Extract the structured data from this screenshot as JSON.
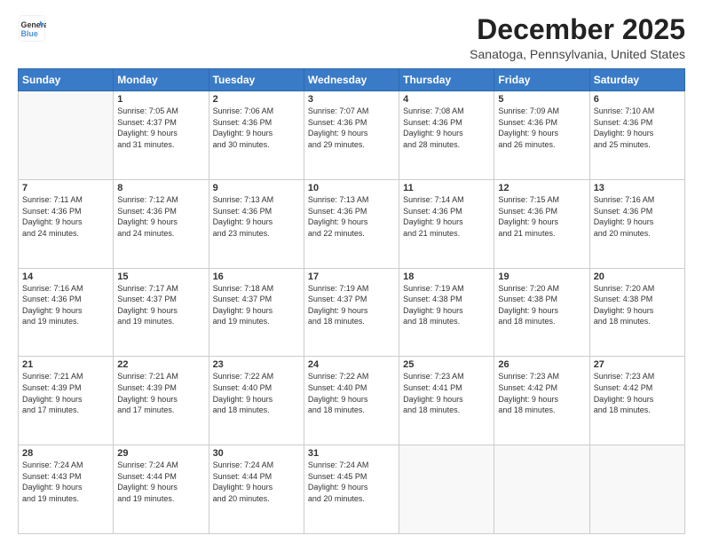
{
  "logo": {
    "line1": "General",
    "line2": "Blue"
  },
  "title": "December 2025",
  "subtitle": "Sanatoga, Pennsylvania, United States",
  "days_of_week": [
    "Sunday",
    "Monday",
    "Tuesday",
    "Wednesday",
    "Thursday",
    "Friday",
    "Saturday"
  ],
  "weeks": [
    [
      {
        "day": "",
        "info": ""
      },
      {
        "day": "1",
        "info": "Sunrise: 7:05 AM\nSunset: 4:37 PM\nDaylight: 9 hours\nand 31 minutes."
      },
      {
        "day": "2",
        "info": "Sunrise: 7:06 AM\nSunset: 4:36 PM\nDaylight: 9 hours\nand 30 minutes."
      },
      {
        "day": "3",
        "info": "Sunrise: 7:07 AM\nSunset: 4:36 PM\nDaylight: 9 hours\nand 29 minutes."
      },
      {
        "day": "4",
        "info": "Sunrise: 7:08 AM\nSunset: 4:36 PM\nDaylight: 9 hours\nand 28 minutes."
      },
      {
        "day": "5",
        "info": "Sunrise: 7:09 AM\nSunset: 4:36 PM\nDaylight: 9 hours\nand 26 minutes."
      },
      {
        "day": "6",
        "info": "Sunrise: 7:10 AM\nSunset: 4:36 PM\nDaylight: 9 hours\nand 25 minutes."
      }
    ],
    [
      {
        "day": "7",
        "info": "Sunrise: 7:11 AM\nSunset: 4:36 PM\nDaylight: 9 hours\nand 24 minutes."
      },
      {
        "day": "8",
        "info": "Sunrise: 7:12 AM\nSunset: 4:36 PM\nDaylight: 9 hours\nand 24 minutes."
      },
      {
        "day": "9",
        "info": "Sunrise: 7:13 AM\nSunset: 4:36 PM\nDaylight: 9 hours\nand 23 minutes."
      },
      {
        "day": "10",
        "info": "Sunrise: 7:13 AM\nSunset: 4:36 PM\nDaylight: 9 hours\nand 22 minutes."
      },
      {
        "day": "11",
        "info": "Sunrise: 7:14 AM\nSunset: 4:36 PM\nDaylight: 9 hours\nand 21 minutes."
      },
      {
        "day": "12",
        "info": "Sunrise: 7:15 AM\nSunset: 4:36 PM\nDaylight: 9 hours\nand 21 minutes."
      },
      {
        "day": "13",
        "info": "Sunrise: 7:16 AM\nSunset: 4:36 PM\nDaylight: 9 hours\nand 20 minutes."
      }
    ],
    [
      {
        "day": "14",
        "info": "Sunrise: 7:16 AM\nSunset: 4:36 PM\nDaylight: 9 hours\nand 19 minutes."
      },
      {
        "day": "15",
        "info": "Sunrise: 7:17 AM\nSunset: 4:37 PM\nDaylight: 9 hours\nand 19 minutes."
      },
      {
        "day": "16",
        "info": "Sunrise: 7:18 AM\nSunset: 4:37 PM\nDaylight: 9 hours\nand 19 minutes."
      },
      {
        "day": "17",
        "info": "Sunrise: 7:19 AM\nSunset: 4:37 PM\nDaylight: 9 hours\nand 18 minutes."
      },
      {
        "day": "18",
        "info": "Sunrise: 7:19 AM\nSunset: 4:38 PM\nDaylight: 9 hours\nand 18 minutes."
      },
      {
        "day": "19",
        "info": "Sunrise: 7:20 AM\nSunset: 4:38 PM\nDaylight: 9 hours\nand 18 minutes."
      },
      {
        "day": "20",
        "info": "Sunrise: 7:20 AM\nSunset: 4:38 PM\nDaylight: 9 hours\nand 18 minutes."
      }
    ],
    [
      {
        "day": "21",
        "info": "Sunrise: 7:21 AM\nSunset: 4:39 PM\nDaylight: 9 hours\nand 17 minutes."
      },
      {
        "day": "22",
        "info": "Sunrise: 7:21 AM\nSunset: 4:39 PM\nDaylight: 9 hours\nand 17 minutes."
      },
      {
        "day": "23",
        "info": "Sunrise: 7:22 AM\nSunset: 4:40 PM\nDaylight: 9 hours\nand 18 minutes."
      },
      {
        "day": "24",
        "info": "Sunrise: 7:22 AM\nSunset: 4:40 PM\nDaylight: 9 hours\nand 18 minutes."
      },
      {
        "day": "25",
        "info": "Sunrise: 7:23 AM\nSunset: 4:41 PM\nDaylight: 9 hours\nand 18 minutes."
      },
      {
        "day": "26",
        "info": "Sunrise: 7:23 AM\nSunset: 4:42 PM\nDaylight: 9 hours\nand 18 minutes."
      },
      {
        "day": "27",
        "info": "Sunrise: 7:23 AM\nSunset: 4:42 PM\nDaylight: 9 hours\nand 18 minutes."
      }
    ],
    [
      {
        "day": "28",
        "info": "Sunrise: 7:24 AM\nSunset: 4:43 PM\nDaylight: 9 hours\nand 19 minutes."
      },
      {
        "day": "29",
        "info": "Sunrise: 7:24 AM\nSunset: 4:44 PM\nDaylight: 9 hours\nand 19 minutes."
      },
      {
        "day": "30",
        "info": "Sunrise: 7:24 AM\nSunset: 4:44 PM\nDaylight: 9 hours\nand 20 minutes."
      },
      {
        "day": "31",
        "info": "Sunrise: 7:24 AM\nSunset: 4:45 PM\nDaylight: 9 hours\nand 20 minutes."
      },
      {
        "day": "",
        "info": ""
      },
      {
        "day": "",
        "info": ""
      },
      {
        "day": "",
        "info": ""
      }
    ]
  ]
}
